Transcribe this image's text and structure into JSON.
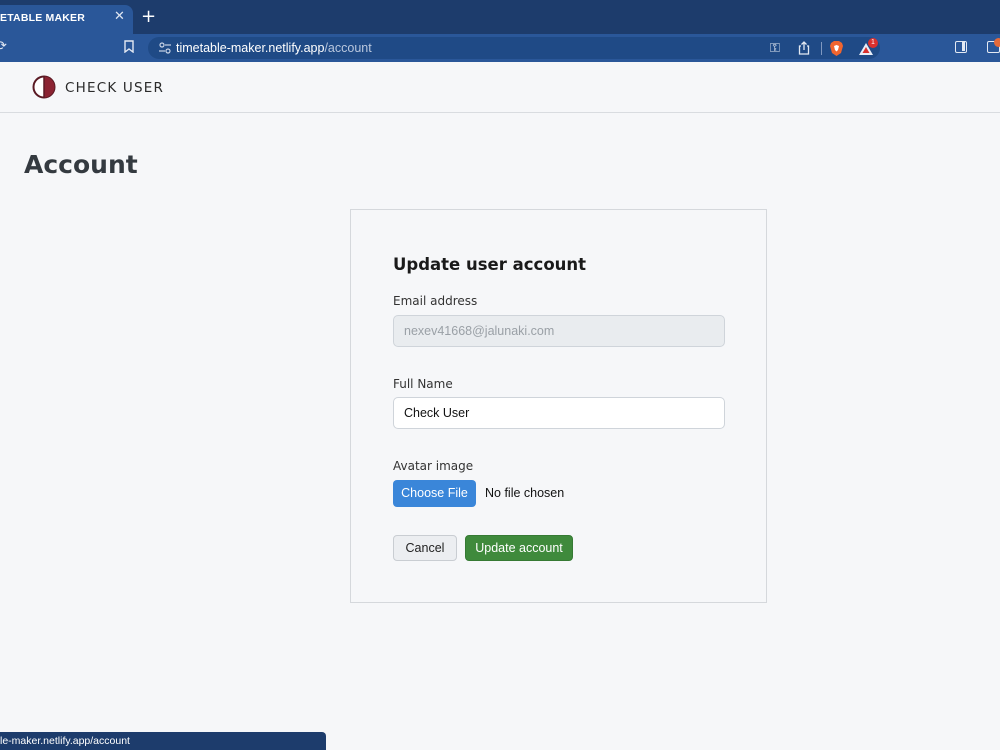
{
  "browser": {
    "tab_title": "ETABLE MAKER",
    "tab_close": "✕",
    "new_tab": "+",
    "url_host": "timetable-maker.netlify.app",
    "url_path": "/account",
    "rewards_count": "1",
    "status_url": "le-maker.netlify.app/account",
    "icons": [
      "reload-icon",
      "bookmark-icon",
      "site-settings-icon",
      "key-icon",
      "share-icon",
      "brave-shield-icon",
      "brave-rewards-icon",
      "sidebar-icon",
      "wallet-icon"
    ]
  },
  "navbar": {
    "brand": "CHECK USER",
    "logo_colors": {
      "ring": "#6b1f2a",
      "fill": "#8b2332"
    }
  },
  "page": {
    "title": "Account"
  },
  "form": {
    "heading": "Update user account",
    "email_label": "Email address",
    "email_value": "nexev41668@jalunaki.com",
    "name_label": "Full Name",
    "name_value": "Check User",
    "avatar_label": "Avatar image",
    "choose_file": "Choose File",
    "file_status": "No file chosen",
    "cancel": "Cancel",
    "update": "Update account"
  },
  "colors": {
    "choose_file_bg": "#3a86d9",
    "update_bg": "#3f8a3c",
    "chrome_bg": "#1d3c6c",
    "toolbar_bg": "#2a5799"
  }
}
